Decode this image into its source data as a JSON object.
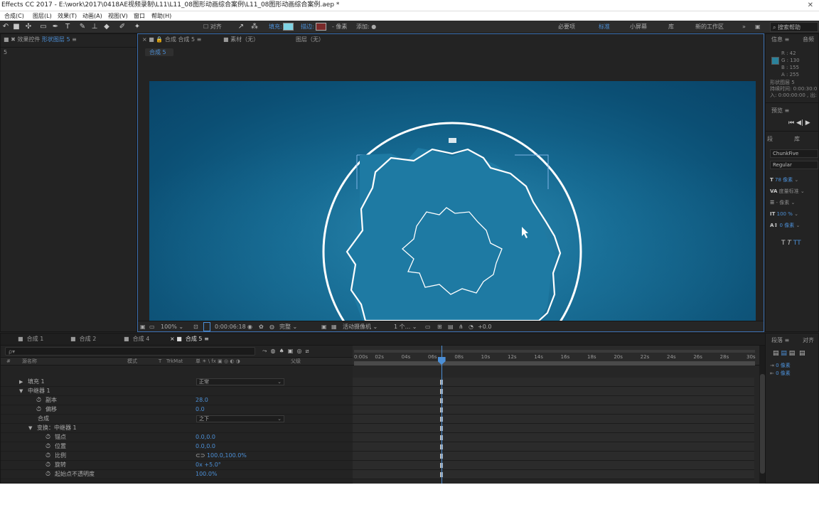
{
  "window": {
    "title": "Effects CC 2017 - E:\\work\\2017\\0418AE视频录制\\L11\\L11_08图形动画综合案例\\L11_08图形动画综合案例.aep *",
    "close": "✕"
  },
  "menu": [
    "合成(C)",
    "图层(L)",
    "效果(T)",
    "动画(A)",
    "视图(V)",
    "窗口",
    "帮助(H)"
  ],
  "toolbar": {
    "align_label": "对齐",
    "fill_label": "填充:",
    "stroke_label": "描边:",
    "stroke_px": "- 像素",
    "add_label": "添加:",
    "workspaces": [
      "必要项",
      "标准",
      "小屏幕",
      "库",
      "新的工作区"
    ],
    "search_help": "搜索帮助",
    "colors": {
      "fill": "#7fd3e3",
      "stroke": "#7a2a2a"
    }
  },
  "left_panel": {
    "tab_label": "效果控件",
    "tab_layer": "形状图层 5",
    "sub_label": "5"
  },
  "comp_panel": {
    "tab_comp": "合成 合成 5",
    "tab_footage": "素材（无）",
    "tab_layer": "图层（无）",
    "breadcrumb": "合成 5",
    "viewer_hint": "▭▭"
  },
  "comp_footer": {
    "zoom": "100%",
    "timecode": "0:00:06:18",
    "quality": "完整",
    "camera": "活动摄像机",
    "views": "1 个...",
    "exposure": "+0.0"
  },
  "info_panel": {
    "tab": "信息",
    "tab2": "音频",
    "r": "R : 42",
    "g": "G : 130",
    "b": "B : 155",
    "a": "A : 255",
    "swatch_color": "#2a829b",
    "layer": "形状图层 5",
    "duration": "持续时间: 0:00:30:0",
    "in_out": "入: 0:00:00:00 , 出:",
    "preview_tab": "预览"
  },
  "char_panel": {
    "tab1": "段",
    "tab2": "库",
    "font": "ChunkFive",
    "style": "Regular",
    "size": "78 像素",
    "kerning": "度量标准",
    "leading": "- 像素",
    "vscale": "100 %",
    "baseline": "0 像素"
  },
  "timeline": {
    "tabs": [
      "合成 1",
      "合成 2",
      "合成 4",
      "合成 5"
    ],
    "search_placeholder": "ρ▾",
    "headers": {
      "num": "#",
      "name": "源名称",
      "mode": "模式",
      "t": "T",
      "trkmat": "TrkMat",
      "switches": "单 ☀ \\ fx ▣ ◎ ◐ ◑",
      "parent": "父级"
    },
    "rows": [
      {
        "name": "填充 1",
        "dd": "正常"
      },
      {
        "name": "中继器 1"
      },
      {
        "name": "副本",
        "value": "28.0"
      },
      {
        "name": "偏移",
        "value": "0.0"
      },
      {
        "name": "合成",
        "dd": "之下"
      },
      {
        "name": "变换：中继器 1"
      },
      {
        "name": "锚点",
        "value": "0.0,0.0"
      },
      {
        "name": "位置",
        "value": "0.0,0.0"
      },
      {
        "name": "比例",
        "value": "100.0,100.0%"
      },
      {
        "name": "旋转",
        "value": "0x +5.0°"
      },
      {
        "name": "起始点不透明度",
        "value": "100.0%"
      }
    ],
    "ruler": [
      "0:00s",
      "02s",
      "04s",
      "06s",
      "08s",
      "10s",
      "12s",
      "14s",
      "16s",
      "18s",
      "20s",
      "22s",
      "24s",
      "26s",
      "28s",
      "30s"
    ],
    "current_time_fraction": 0.219
  },
  "right_bottom": {
    "tab": "段落",
    "tab2": "对齐",
    "indent_left": "0 像素",
    "indent_right": "0 像素"
  }
}
